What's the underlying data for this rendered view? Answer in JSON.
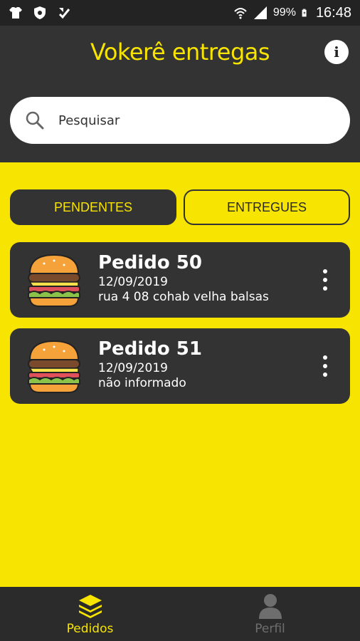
{
  "status_bar": {
    "battery_percent": "99%",
    "time": "16:48"
  },
  "header": {
    "title": "Vokerê entregas",
    "info_icon": "info-icon"
  },
  "search": {
    "placeholder": "Pesquisar"
  },
  "tabs": [
    {
      "label": "PENDENTES",
      "active": true
    },
    {
      "label": "ENTREGUES",
      "active": false
    }
  ],
  "orders": [
    {
      "title": "Pedido 50",
      "date": "12/09/2019",
      "address": "rua 4 08 cohab velha balsas",
      "icon": "burger-icon"
    },
    {
      "title": "Pedido 51",
      "date": "12/09/2019",
      "address": "não informado",
      "icon": "burger-icon"
    }
  ],
  "bottom_nav": [
    {
      "label": "Pedidos",
      "icon": "layers-icon",
      "active": true
    },
    {
      "label": "Perfil",
      "icon": "person-icon",
      "active": false
    }
  ],
  "colors": {
    "accent": "#f7e400",
    "dark": "#333333",
    "statusbar": "#232323"
  }
}
